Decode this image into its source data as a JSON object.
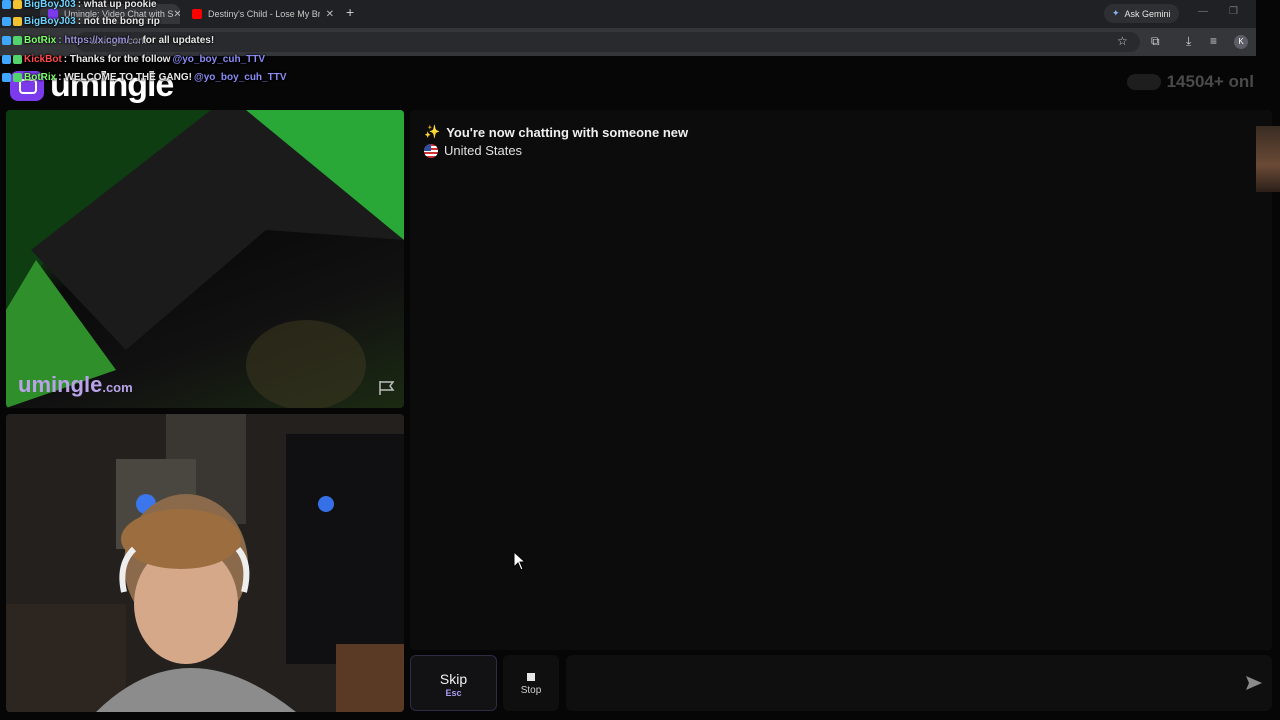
{
  "browser": {
    "tabs": [
      {
        "title": "Umingle: Video Chat with S",
        "favicon_color": "#7c3aed",
        "active": true
      },
      {
        "title": "Destiny's Child - Lose My Breath",
        "favicon_color": "#ff0000",
        "active": false
      }
    ],
    "ask_gemini": "Ask Gemini",
    "address": "umingle.com",
    "profile_initial": "K"
  },
  "overlay_chat": [
    {
      "user": "BigBoyJ03",
      "user_color": "#6fd3ff",
      "text": ": what up pookie"
    },
    {
      "user": "BigBoyJ03",
      "user_color": "#6fd3ff",
      "text": ": not the bong rip"
    },
    {
      "user": "BotRix",
      "user_color": "#7dff6b",
      "text": ": https://x.com/ ... ",
      "tail": "for all updates!"
    },
    {
      "user": "KickBot",
      "user_color": "#ff4b4b",
      "text": ": Thanks for the follow ",
      "mention": "@yo_boy_cuh_TTV"
    },
    {
      "user": "BotRix",
      "user_color": "#7dff6b",
      "text": ": WELCOME TO THE GANG! ",
      "mention": "@yo_boy_cuh_TTV"
    }
  ],
  "site": {
    "logo_text": "umingle",
    "online_count": "14504+ onl"
  },
  "stranger": {
    "watermark_main": "umingle",
    "watermark_suffix": ".com"
  },
  "chat": {
    "system_message": "You're now chatting with someone new",
    "sparkle": "✨",
    "country": "United States"
  },
  "controls": {
    "skip_label": "Skip",
    "skip_key": "Esc",
    "stop_label": "Stop",
    "input_placeholder": ""
  },
  "colors": {
    "accent": "#7c3aed",
    "skip_key": "#a89cf0",
    "background": "#060606"
  }
}
